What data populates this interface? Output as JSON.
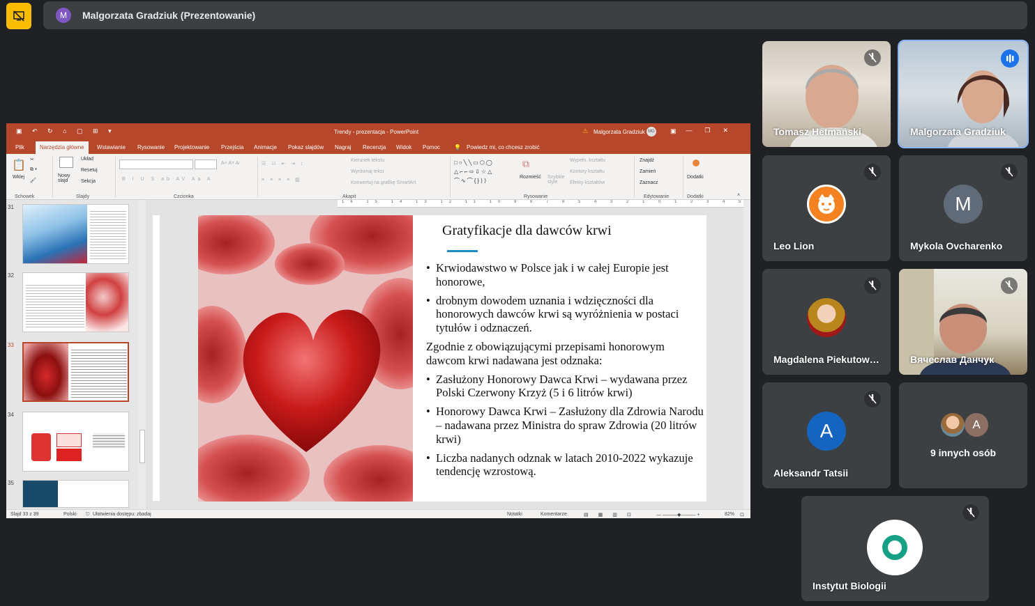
{
  "meet": {
    "presenter_initial": "M",
    "presenter_label": "Malgorzata Gradziuk (Prezentowanie)",
    "others_count": "9 innych osób",
    "others_initial": "A",
    "participants": [
      {
        "name": "Tomasz Hetmański",
        "muted": true
      },
      {
        "name": "Malgorzata Gradziuk",
        "speaking": true
      },
      {
        "name": "Leo Lion",
        "muted": true
      },
      {
        "name": "Mykola Ovcharenko",
        "initial": "M",
        "muted": true
      },
      {
        "name": "Magdalena Piekutow…",
        "muted": true
      },
      {
        "name": "Вячеслав Данчук",
        "muted": true
      },
      {
        "name": "Aleksandr Tatsii",
        "initial": "A",
        "muted": true
      },
      {
        "name": "Instytut Biologii",
        "muted": true
      }
    ]
  },
  "ppt": {
    "window_title": "Trendy - prezentacja  -  PowerPoint",
    "user": "Malgorzata Gradziuk",
    "user_badge": "MG",
    "tabs": [
      "Plik",
      "Narzędzia główne",
      "Wstawianie",
      "Rysowanie",
      "Projektowanie",
      "Przejścia",
      "Animacje",
      "Pokaz slajdów",
      "Nagraj",
      "Recenzja",
      "Widok",
      "Pomoc"
    ],
    "tell_me": "Powiedz mi, co chcesz zrobić",
    "ribbon": {
      "paste": "Wklej",
      "new_slide": "Nowy slajd",
      "layout": "Układ",
      "reset": "Resetuj",
      "section": "Sekcja",
      "text_direction": "Kierunek tekstu",
      "align_text": "Wyrównaj tekst",
      "smartart": "Konwertuj na grafikę SmartArt",
      "arrange": "Rozmieść",
      "quick_styles": "Szybkie style",
      "fill": "Wypełn. kształtu",
      "outline": "Kontury kształtu",
      "effects": "Efekty kształtów",
      "find": "Znajdź",
      "replace": "Zamień",
      "select": "Zaznacz",
      "addins": "Dodatki",
      "groups": {
        "clipboard": "Schowek",
        "slides": "Slajdy",
        "font": "Czcionka",
        "paragraph": "Akapit",
        "drawing": "Rysowanie",
        "editing": "Edytowanie",
        "addins": "Dodatki"
      }
    },
    "thumb_numbers": [
      "31",
      "32",
      "33",
      "34",
      "35"
    ],
    "current_thumb": 2,
    "ruler": "16 15 14 13 12 11 10 9 8 7 6 5 4 3 2 1 0 1 2 3 4 5 6 7 8 9 10 11 12 13 14 15 16",
    "slide": {
      "title": "Gratyfikacje dla dawców krwi",
      "bullets_a": [
        "Krwiodawstwo w Polsce jak i w całej Europie jest honorowe,",
        "drobnym dowodem uznania i wdzięczności dla honorowych dawców krwi są wyróżnienia w postaci tytułów i odznaczeń."
      ],
      "paragraph": "Zgodnie z obowiązującymi przepisami honorowym dawcom krwi nadawana jest odznaka:",
      "bullets_b": [
        "Zasłużony Honorowy Dawca Krwi – wydawana przez Polski Czerwony Krzyż (5 i 6 litrów krwi)",
        "Honorowy Dawca Krwi – Zasłużony dla Zdrowia Narodu – nadawana przez Ministra do spraw Zdrowia (20 litrów krwi)",
        "Liczba nadanych odznak w latach 2010-2022 wykazuje tendencję wzrostową."
      ]
    },
    "status": {
      "slide_pos": "Slajd 33 z 39",
      "language": "Polski",
      "accessibility": "Ułatwienia dostępu: zbadaj",
      "notes": "Notatki",
      "comments": "Komentarze",
      "zoom": "82%"
    }
  }
}
